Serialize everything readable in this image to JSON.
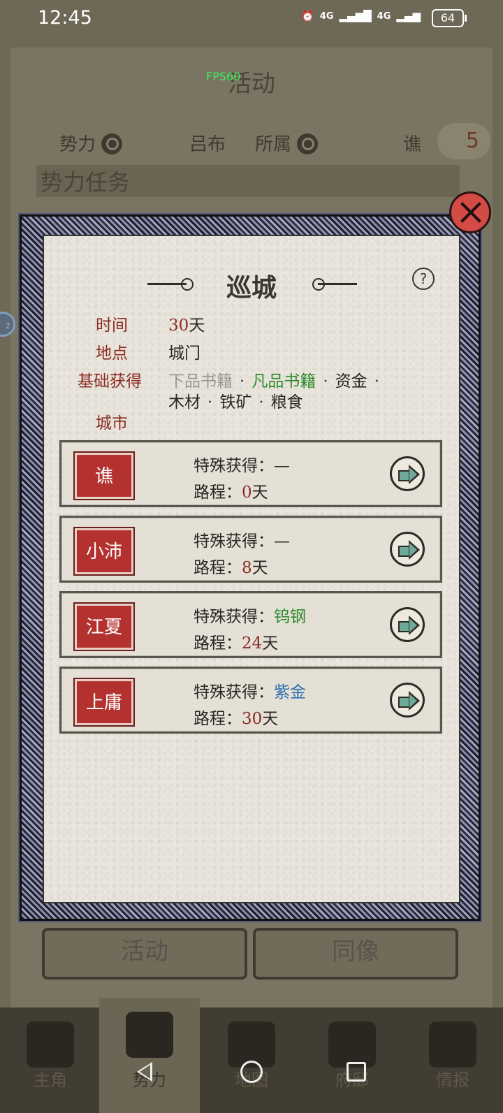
{
  "status_bar": {
    "time": "12:45",
    "network1": "4G",
    "network2": "4G",
    "battery": "64"
  },
  "overlay": {
    "fps": "FPS60"
  },
  "background": {
    "page_title": "活动",
    "filter": {
      "faction_label": "势力",
      "faction_value": "吕布",
      "belong_label": "所属",
      "belong_value": "谯",
      "badge": "5"
    },
    "section_title": "势力任务",
    "buttons": [
      "活动",
      "同像"
    ],
    "sidebar_hint": "2"
  },
  "modal": {
    "title": "巡城",
    "help": "?",
    "time_label": "时间",
    "time_num": "30",
    "time_unit": "天",
    "place_label": "地点",
    "place_value": "城门",
    "rewards_label": "基础获得",
    "rewards": [
      {
        "name": "下品书籍",
        "color": "#9a968e"
      },
      {
        "name": "凡品书籍",
        "color": "#2c8a2c"
      },
      {
        "name": "资金",
        "color": "#2a2622"
      },
      {
        "name": "木材",
        "color": "#2a2622"
      },
      {
        "name": "铁矿",
        "color": "#2a2622"
      },
      {
        "name": "粮食",
        "color": "#2a2622"
      }
    ],
    "city_label": "城市",
    "special_label": "特殊获得：",
    "route_label": "路程：",
    "day_unit": "天",
    "cities": [
      {
        "name": "谯",
        "special": "—",
        "special_color": "#2a2622",
        "days": "0"
      },
      {
        "name": "小沛",
        "special": "—",
        "special_color": "#2a2622",
        "days": "8"
      },
      {
        "name": "江夏",
        "special": "钨钢",
        "special_color": "#2c8a2c",
        "days": "24"
      },
      {
        "name": "上庸",
        "special": "紫金",
        "special_color": "#2f6faa",
        "days": "30"
      }
    ]
  },
  "bottom_nav": {
    "tabs": [
      "主角",
      "势力",
      "地图",
      "府邸",
      "情报"
    ],
    "active": "势力"
  }
}
